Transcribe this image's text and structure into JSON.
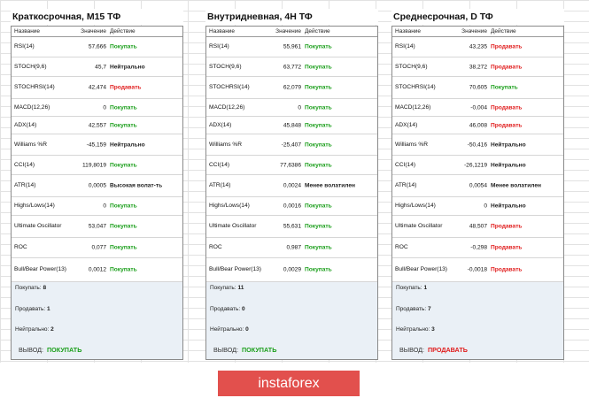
{
  "header_labels": {
    "name": "Название",
    "value": "Значение",
    "action": "Действие"
  },
  "summary_labels": {
    "buy": "Покупать:",
    "sell": "Продавать:",
    "neutral": "Нейтрально:",
    "verdict": "ВЫВОД:"
  },
  "panels": [
    {
      "title": "Краткосрочная, M15 ТФ",
      "rows": [
        {
          "name": "RSI(14)",
          "value": "57,666",
          "action": "Покупать",
          "tone": "buy"
        },
        {
          "name": "STOCH(9,6)",
          "value": "45,7",
          "action": "Нейтрально",
          "tone": "neutral"
        },
        {
          "name": "STOCHRSI(14)",
          "value": "42,474",
          "action": "Продавать",
          "tone": "sell"
        },
        {
          "name": "MACD(12,26)",
          "value": "0",
          "action": "Покупать",
          "tone": "buy"
        },
        {
          "name": "ADX(14)",
          "value": "42,557",
          "action": "Покупать",
          "tone": "buy"
        },
        {
          "name": "Williams %R",
          "value": "-45,159",
          "action": "Нейтрально",
          "tone": "neutral"
        },
        {
          "name": "CCI(14)",
          "value": "119,8019",
          "action": "Покупать",
          "tone": "buy"
        },
        {
          "name": "ATR(14)",
          "value": "0,0005",
          "action": "Высокая волат-ть",
          "tone": "neutral"
        },
        {
          "name": "Highs/Lows(14)",
          "value": "0",
          "action": "Покупать",
          "tone": "buy"
        },
        {
          "name": "Ultimate Oscillator",
          "value": "53,047",
          "action": "Покупать",
          "tone": "buy"
        },
        {
          "name": "ROC",
          "value": "0,077",
          "action": "Покупать",
          "tone": "buy"
        },
        {
          "name": "Bull/Bear Power(13)",
          "value": "0,0012",
          "action": "Покупать",
          "tone": "buy"
        }
      ],
      "summary": {
        "buy": "8",
        "sell": "1",
        "neutral": "2",
        "verdict": "ПОКУПАТЬ",
        "verdict_tone": "buy"
      }
    },
    {
      "title": "Внутридневная, 4H ТФ",
      "rows": [
        {
          "name": "RSI(14)",
          "value": "55,961",
          "action": "Покупать",
          "tone": "buy"
        },
        {
          "name": "STOCH(9,6)",
          "value": "63,772",
          "action": "Покупать",
          "tone": "buy"
        },
        {
          "name": "STOCHRSI(14)",
          "value": "62,079",
          "action": "Покупать",
          "tone": "buy"
        },
        {
          "name": "MACD(12,26)",
          "value": "0",
          "action": "Покупать",
          "tone": "buy"
        },
        {
          "name": "ADX(14)",
          "value": "45,848",
          "action": "Покупать",
          "tone": "buy"
        },
        {
          "name": "Williams %R",
          "value": "-25,407",
          "action": "Покупать",
          "tone": "buy"
        },
        {
          "name": "CCI(14)",
          "value": "77,6386",
          "action": "Покупать",
          "tone": "buy"
        },
        {
          "name": "ATR(14)",
          "value": "0,0024",
          "action": "Менее волатилен",
          "tone": "neutral"
        },
        {
          "name": "Highs/Lows(14)",
          "value": "0,0016",
          "action": "Покупать",
          "tone": "buy"
        },
        {
          "name": "Ultimate Oscillator",
          "value": "55,631",
          "action": "Покупать",
          "tone": "buy"
        },
        {
          "name": "ROC",
          "value": "0,987",
          "action": "Покупать",
          "tone": "buy"
        },
        {
          "name": "Bull/Bear Power(13)",
          "value": "0,0029",
          "action": "Покупать",
          "tone": "buy"
        }
      ],
      "summary": {
        "buy": "11",
        "sell": "0",
        "neutral": "0",
        "verdict": "ПОКУПАТЬ",
        "verdict_tone": "buy"
      }
    },
    {
      "title": "Среднесрочная, D ТФ",
      "rows": [
        {
          "name": "RSI(14)",
          "value": "43,235",
          "action": "Продавать",
          "tone": "sell"
        },
        {
          "name": "STOCH(9,6)",
          "value": "38,272",
          "action": "Продавать",
          "tone": "sell"
        },
        {
          "name": "STOCHRSI(14)",
          "value": "70,605",
          "action": "Покупать",
          "tone": "buy"
        },
        {
          "name": "MACD(12,26)",
          "value": "-0,004",
          "action": "Продавать",
          "tone": "sell"
        },
        {
          "name": "ADX(14)",
          "value": "46,008",
          "action": "Продавать",
          "tone": "sell"
        },
        {
          "name": "Williams %R",
          "value": "-50,416",
          "action": "Нейтрально",
          "tone": "neutral"
        },
        {
          "name": "CCI(14)",
          "value": "-26,1219",
          "action": "Нейтрально",
          "tone": "neutral"
        },
        {
          "name": "ATR(14)",
          "value": "0,0054",
          "action": "Менее волатилен",
          "tone": "neutral"
        },
        {
          "name": "Highs/Lows(14)",
          "value": "0",
          "action": "Нейтрально",
          "tone": "neutral"
        },
        {
          "name": "Ultimate Oscillator",
          "value": "48,507",
          "action": "Продавать",
          "tone": "sell"
        },
        {
          "name": "ROC",
          "value": "-0,298",
          "action": "Продавать",
          "tone": "sell"
        },
        {
          "name": "Bull/Bear Power(13)",
          "value": "-0,0018",
          "action": "Продавать",
          "tone": "sell"
        }
      ],
      "summary": {
        "buy": "1",
        "sell": "7",
        "neutral": "3",
        "verdict": "ПРОДАВАТЬ",
        "verdict_tone": "sell"
      }
    }
  ],
  "logo": {
    "text": "instaforex"
  },
  "colors": {
    "buy": "#1a9e1a",
    "sell": "#e01a1a",
    "summary_bg": "#eaf0f6",
    "logo_bg": "#e2504d"
  }
}
